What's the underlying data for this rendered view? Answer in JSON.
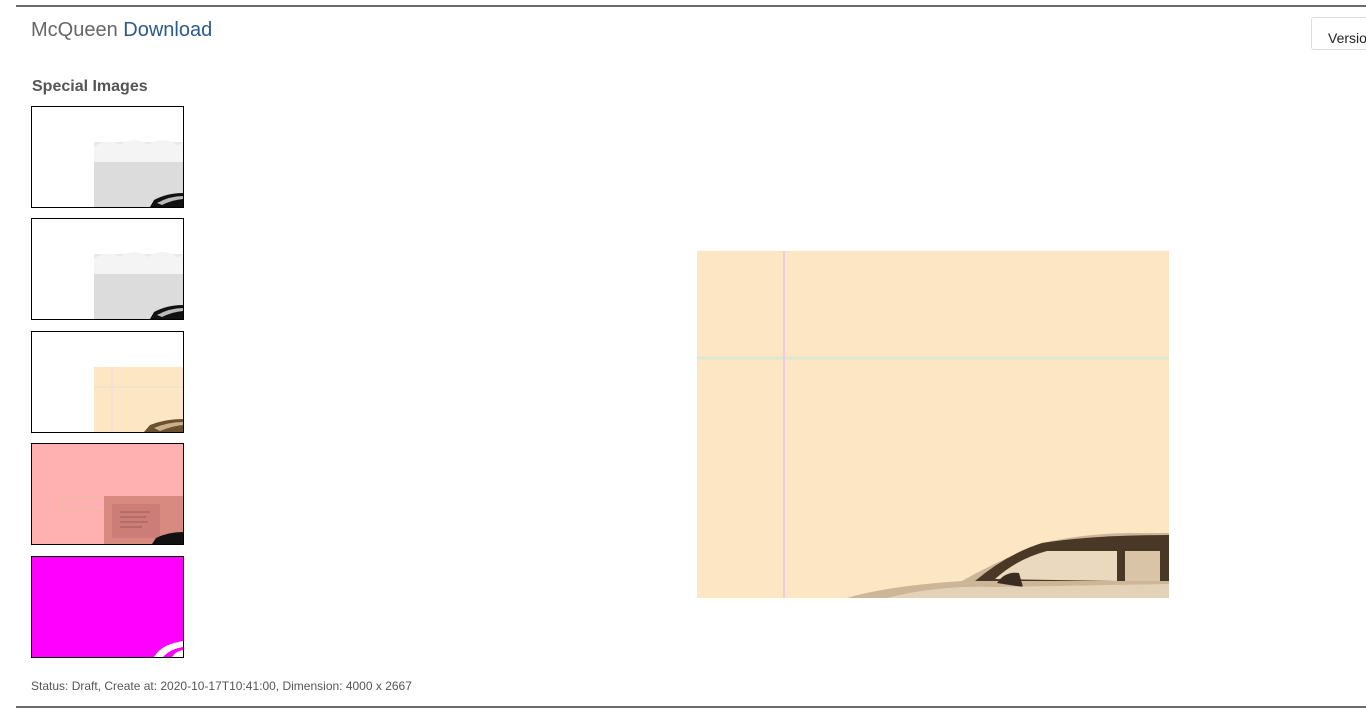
{
  "header": {
    "title_prefix": "McQueen",
    "title_link": "Download",
    "version_button": "Version"
  },
  "sidebar": {
    "section_title": "Special Images",
    "thumbnails": [
      {
        "name": "thumbnail-1",
        "style": "grey"
      },
      {
        "name": "thumbnail-2",
        "style": "grey"
      },
      {
        "name": "thumbnail-3",
        "style": "sepia"
      },
      {
        "name": "thumbnail-4",
        "style": "pink"
      },
      {
        "name": "thumbnail-5",
        "style": "magenta"
      }
    ]
  },
  "colors": {
    "rule": "#6b6b6b",
    "link": "#2b5a8a",
    "sepia_bg": "#fde6c3",
    "pink_bg": "#ffb0b0",
    "magenta": "#ff00ff"
  },
  "footer": {
    "status_text": "Status: Draft, Create at: 2020-10-17T10:41:00, Dimension: 4000 x 2667"
  }
}
